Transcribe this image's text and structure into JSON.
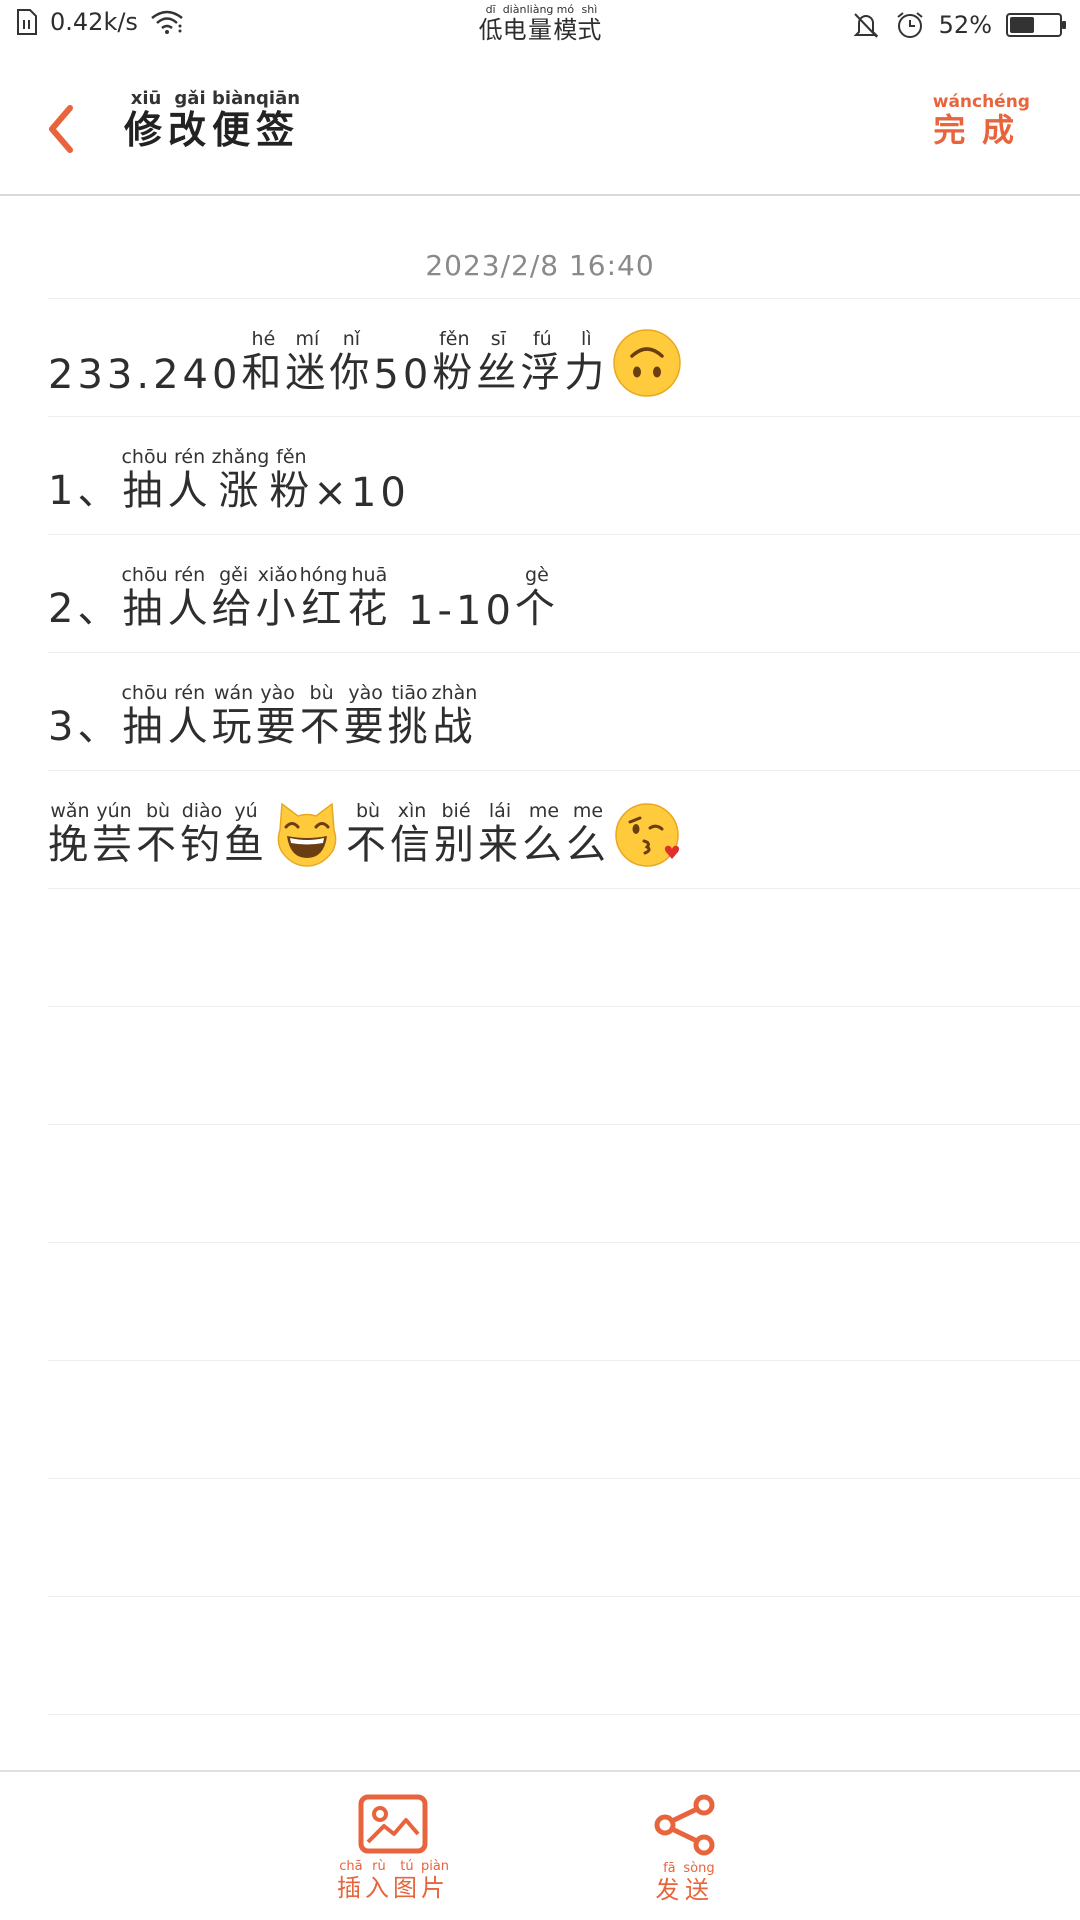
{
  "status_bar": {
    "network_speed": "0.42k/s",
    "mode_chars": [
      "低",
      "电",
      "量",
      "模",
      "式"
    ],
    "mode_pinyin": [
      "dī",
      "diàn",
      "liàng",
      "mó",
      "shì"
    ],
    "battery_percent": "52%",
    "battery_level": 0.52
  },
  "header": {
    "title_chars": [
      "修",
      "改",
      "便",
      "签"
    ],
    "title_pinyin": [
      "xiū",
      "gǎi",
      "biàn",
      "qiān"
    ],
    "done_chars": [
      "完",
      "成"
    ],
    "done_pinyin": [
      "wán",
      "chéng"
    ]
  },
  "note": {
    "date": "2023/2/8 16:40",
    "line1": {
      "prefix": "233.240",
      "chars": [
        "和",
        "迷",
        "你"
      ],
      "pinyin": [
        "hé",
        "mí",
        "nǐ"
      ],
      "mid": "50",
      "chars2": [
        "粉",
        "丝",
        "浮",
        "力"
      ],
      "pinyin2": [
        "fěn",
        "sī",
        "fú",
        "lì"
      ],
      "emoji": "upside-down-face-emoji"
    },
    "line2": {
      "prefix": "1、",
      "chars": [
        "抽",
        "人",
        "涨",
        "粉"
      ],
      "pinyin": [
        "chōu",
        "rén",
        "zhǎng",
        "fěn"
      ],
      "suffix": "×10"
    },
    "line3": {
      "prefix": "2、",
      "chars": [
        "抽",
        "人",
        "给",
        "小",
        "红",
        "花"
      ],
      "pinyin": [
        "chōu",
        "rén",
        "gěi",
        "xiǎo",
        "hóng",
        "huā"
      ],
      "mid": " 1-10",
      "chars2": [
        "个"
      ],
      "pinyin2": [
        "gè"
      ]
    },
    "line4": {
      "prefix": "3、",
      "chars": [
        "抽",
        "人",
        "玩",
        "要",
        "不",
        "要",
        "挑",
        "战"
      ],
      "pinyin": [
        "chōu",
        "rén",
        "wán",
        "yào",
        "bù",
        "yào",
        "tiāo",
        "zhàn"
      ]
    },
    "line5": {
      "chars": [
        "挽",
        "芸",
        "不",
        "钓",
        "鱼"
      ],
      "pinyin": [
        "wǎn",
        "yún",
        "bù",
        "diào",
        "yú"
      ],
      "chars2": [
        "不",
        "信",
        "别",
        "来",
        "么",
        "么"
      ],
      "pinyin2": [
        "bù",
        "xìn",
        "bié",
        "lái",
        "me",
        "me"
      ],
      "emoji1": "grinning-cat-emoji",
      "emoji2": "kissing-face-emoji"
    }
  },
  "toolbar": {
    "insert_chars": [
      "插",
      "入",
      "图",
      "片"
    ],
    "insert_pinyin": [
      "chā",
      "rù",
      "tú",
      "piàn"
    ],
    "send_chars": [
      "发",
      "送"
    ],
    "send_pinyin": [
      "fā",
      "sòng"
    ]
  },
  "colors": {
    "accent": "#e8643c",
    "text": "#2e2e2e",
    "muted": "#8a8a8a",
    "rule": "#eeeeee"
  }
}
